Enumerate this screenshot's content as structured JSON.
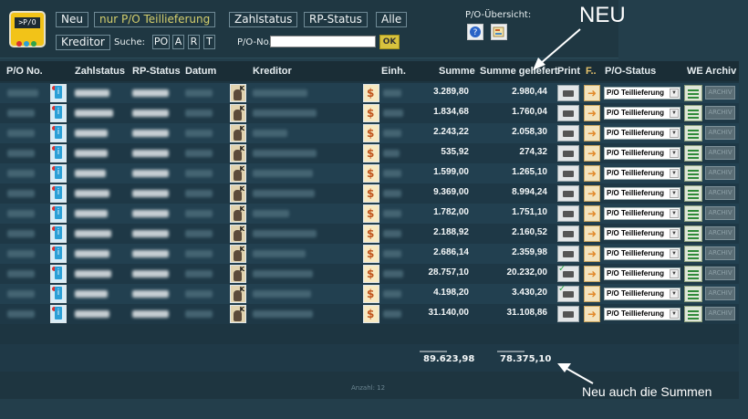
{
  "toolbar": {
    "buttons_row1": [
      "Neu",
      "nur P/O Teillieferung",
      "Zahlstatus",
      "RP-Status",
      "Alle"
    ],
    "kreditor_label": "Kreditor",
    "suche_label": "Suche:",
    "letters": [
      "PO",
      "A",
      "R",
      "T"
    ],
    "po_no_label": "P/O-No.",
    "ok_label": "OK",
    "po_uebersicht_label": "P/O-Übersicht:",
    "logo_text": ">P/O"
  },
  "annotations": {
    "neu": "NEU",
    "neu_summen": "Neu auch die Summen"
  },
  "table": {
    "headers": [
      "P/O No.",
      "Zahlstatus",
      "RP-Status",
      "Datum",
      "Kreditor",
      "Einh.",
      "Summe",
      "Summe geliefert",
      "Print",
      "F..",
      "P/O-Status",
      "WE",
      "Archiv"
    ],
    "status_option": "P/O Teillieferung",
    "archive_label": "ARCHIV",
    "rows": [
      {
        "summe": "3.289,80",
        "geliefert": "2.980,44",
        "printed": false
      },
      {
        "summe": "1.834,68",
        "geliefert": "1.760,04",
        "printed": false
      },
      {
        "summe": "2.243,22",
        "geliefert": "2.058,30",
        "printed": false
      },
      {
        "summe": "535,92",
        "geliefert": "274,32",
        "printed": false
      },
      {
        "summe": "1.599,00",
        "geliefert": "1.265,10",
        "printed": false
      },
      {
        "summe": "9.369,00",
        "geliefert": "8.994,24",
        "printed": false
      },
      {
        "summe": "1.782,00",
        "geliefert": "1.751,10",
        "printed": false
      },
      {
        "summe": "2.188,92",
        "geliefert": "2.160,52",
        "printed": false
      },
      {
        "summe": "2.686,14",
        "geliefert": "2.359,98",
        "printed": false
      },
      {
        "summe": "28.757,10",
        "geliefert": "20.232,00",
        "printed": true
      },
      {
        "summe": "4.198,20",
        "geliefert": "3.430,20",
        "printed": true
      },
      {
        "summe": "31.140,00",
        "geliefert": "31.108,86",
        "printed": false
      }
    ],
    "sum_separator": "______",
    "total_summe": "89.623,98",
    "total_geliefert": "78.375,10",
    "anzahl": "Anzahl: 12"
  },
  "colors": {
    "background": "#233e4b",
    "accent_yellow": "#f2c318",
    "active_button_text": "#d5cf6d"
  }
}
